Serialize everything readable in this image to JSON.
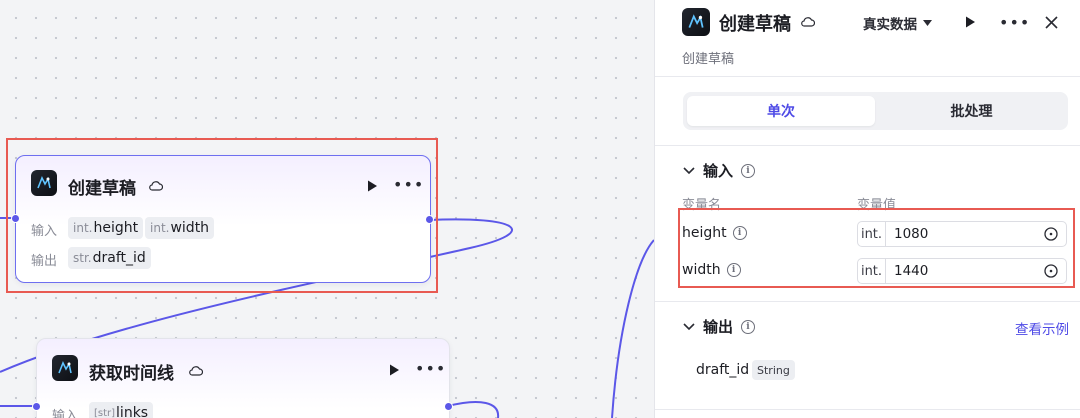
{
  "canvas": {
    "nodes": [
      {
        "title": "创建草稿",
        "input_label": "输入",
        "output_label": "输出",
        "inputs": [
          {
            "type": "int.",
            "name": "height"
          },
          {
            "type": "int.",
            "name": "width"
          }
        ],
        "outputs": [
          {
            "type": "str.",
            "name": "draft_id"
          }
        ]
      },
      {
        "title": "获取时间线",
        "input_label": "输入",
        "inputs": [
          {
            "type": "[str]",
            "name": "links"
          }
        ]
      }
    ]
  },
  "panel": {
    "title": "创建草稿",
    "subtitle": "创建草稿",
    "mode_select": "真实数据",
    "tabs": [
      "单次",
      "批处理"
    ],
    "active_tab": "单次",
    "input_section": {
      "title": "输入",
      "col_name": "变量名",
      "col_value": "变量值",
      "vars": [
        {
          "name": "height",
          "type": "int.",
          "value": "1080"
        },
        {
          "name": "width",
          "type": "int.",
          "value": "1440"
        }
      ]
    },
    "output_section": {
      "title": "输出",
      "example_link": "查看示例",
      "vars": [
        {
          "name": "draft_id",
          "type": "String"
        }
      ]
    }
  },
  "colors": {
    "accent": "#4e4ae6",
    "highlight": "#e85a52",
    "connector": "#5b57e8"
  },
  "icons": [
    "plugin-logo-icon",
    "cloud-icon",
    "play-icon",
    "more-icon",
    "close-icon",
    "chevron-down-icon",
    "info-icon",
    "variable-picker-icon",
    "caret-down-icon"
  ]
}
